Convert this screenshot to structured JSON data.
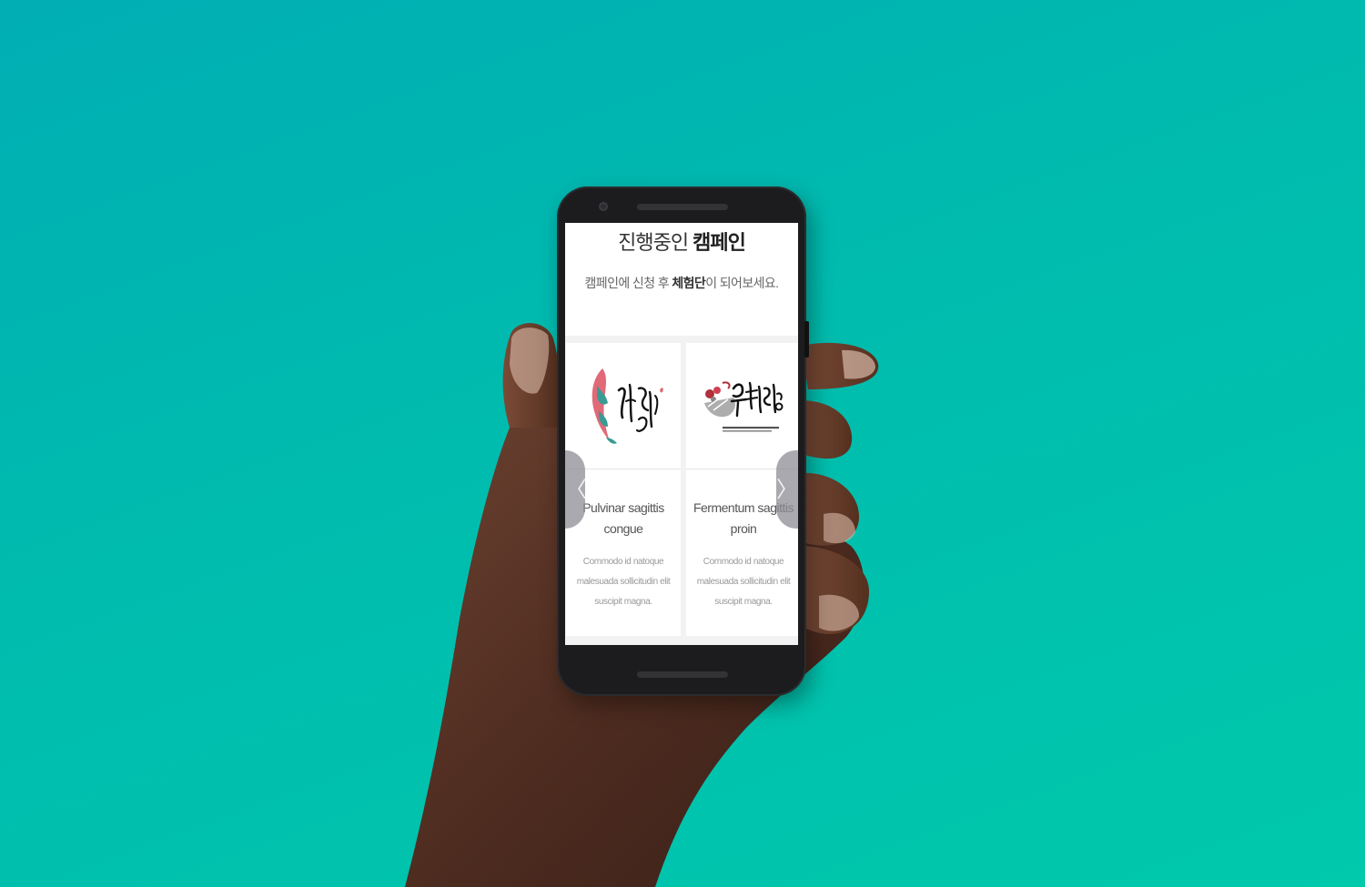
{
  "page": {
    "title_light": "진행중인 ",
    "title_bold": "캠페인",
    "subtitle_pre": "캠페인에 신청 후 ",
    "subtitle_bold": "체험단",
    "subtitle_post": "이 되어보세요."
  },
  "carousel": {
    "prev_icon": "chevron-left-icon",
    "next_icon": "chevron-right-icon",
    "prev_glyph": "〈",
    "next_glyph": "〉"
  },
  "cards": [
    {
      "title": "Pulvinar sagittis congue",
      "description": "Commodo id natoque malesuada sollicitudin elit suscipit magna."
    },
    {
      "title": "Fermentum sagittis proin",
      "description": "Commodo id natoque malesuada sollicitudin elit suscipit magna."
    }
  ],
  "colors": {
    "background_top": "#00aeb4",
    "background_bottom": "#00c9ac",
    "phone_body": "#1c1c1e",
    "logo_pink": "#e06a78",
    "logo_teal": "#3a9a94"
  }
}
